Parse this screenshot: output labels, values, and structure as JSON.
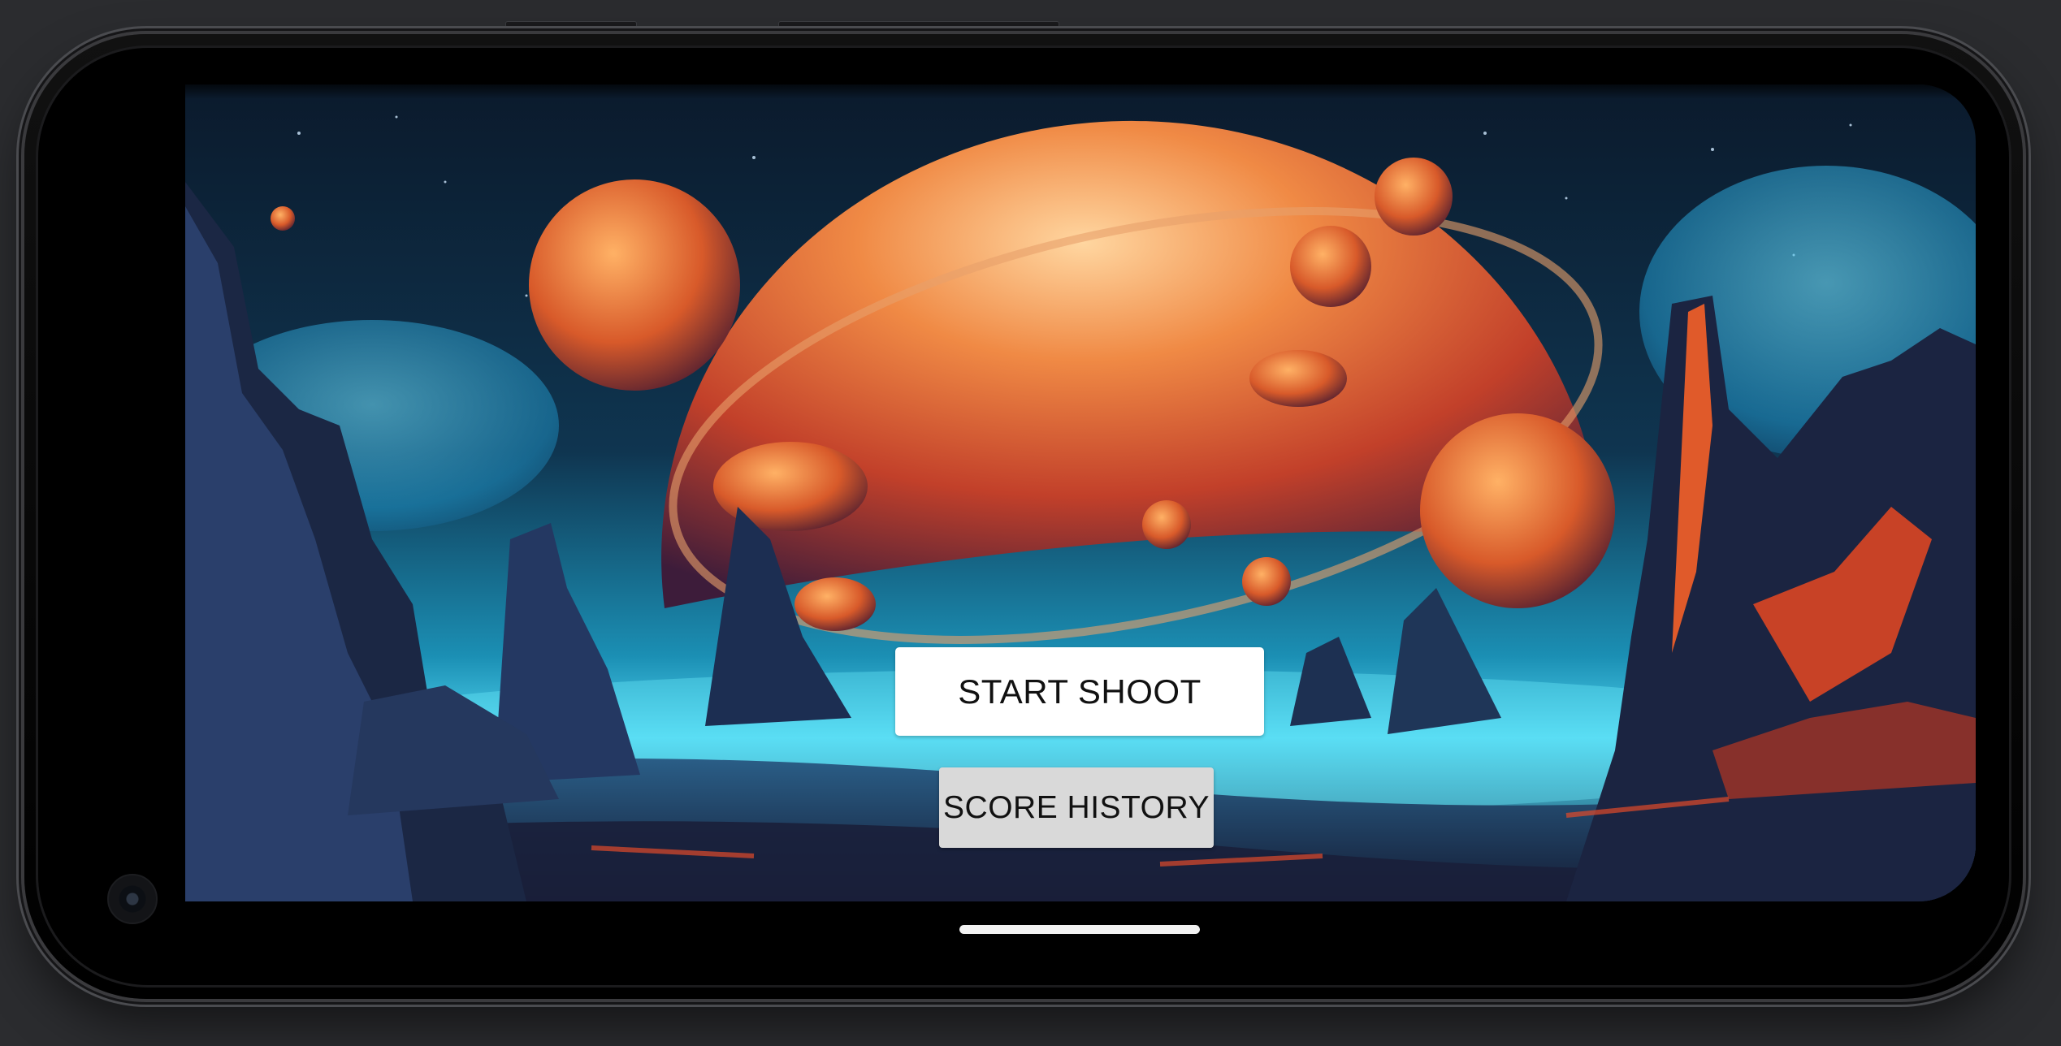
{
  "app": {
    "screen": "main-menu"
  },
  "buttons": {
    "start_label": "START SHOOT",
    "history_label": "SCORE HISTORY"
  },
  "colors": {
    "start_button_bg": "#ffffff",
    "history_button_bg": "#d9d9d9",
    "device_frame": "#000000",
    "page_background": "#2b2c2f"
  },
  "icons": {
    "camera": "front-camera-icon",
    "home": "home-indicator"
  }
}
